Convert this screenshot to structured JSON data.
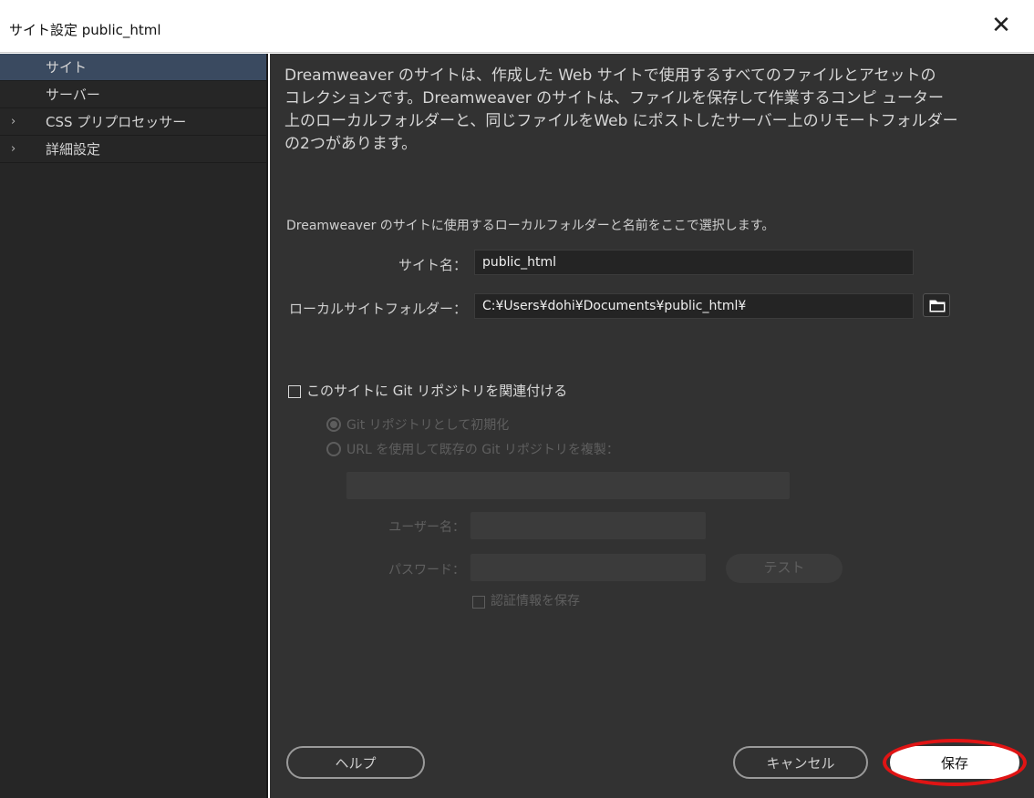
{
  "window": {
    "title": "サイト設定 public_html",
    "close_icon": "close-icon"
  },
  "sidebar": {
    "items": [
      {
        "label": "サイト",
        "expandable": false,
        "active": true
      },
      {
        "label": "サーバー",
        "expandable": false,
        "active": false
      },
      {
        "label": "CSS プリプロセッサー",
        "expandable": true,
        "active": false
      },
      {
        "label": "詳細設定",
        "expandable": true,
        "active": false
      }
    ]
  },
  "main": {
    "intro_line1": "Dreamweaver のサイトは、作成した Web サイトで使用するすべてのファイルとアセットの",
    "intro_line2": "コレクションです。Dreamweaver のサイトは、ファイルを保存して作業するコンピ ューター",
    "intro_line3": "上のローカルフォルダーと、同じファイルをWeb にポストしたサーバー上のリモートフォルダー",
    "intro_line4": "の2つがあります。",
    "subdesc": "Dreamweaver のサイトに使用するローカルフォルダーと名前をここで選択します。",
    "site_name_label": "サイト名：",
    "site_name_value": "public_html",
    "local_folder_label": "ローカルサイトフォルダー：",
    "local_folder_value": "C:¥Users¥dohi¥Documents¥public_html¥",
    "folder_icon": "folder-icon",
    "git_checkbox_label": "このサイトに Git リポジトリを関連付ける",
    "git_checked": false,
    "radio_init_label": "Git リポジトリとして初期化",
    "radio_clone_label": "URL を使用して既存の Git リポジトリを複製：",
    "username_label": "ユーザー名：",
    "password_label": "パスワード：",
    "test_label": "テスト",
    "save_credentials_label": "認証情報を保存"
  },
  "footer": {
    "help_label": "ヘルプ",
    "cancel_label": "キャンセル",
    "save_label": "保存"
  },
  "colors": {
    "sidebar_bg": "#262626",
    "main_bg": "#323232",
    "active_item": "#3a4a60",
    "annotation": "#e01414"
  }
}
